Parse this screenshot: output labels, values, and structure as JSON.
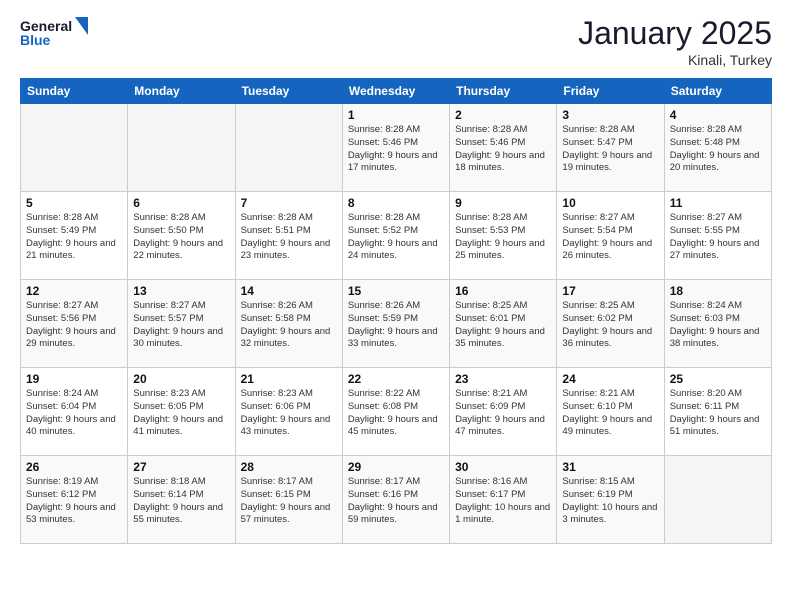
{
  "logo": {
    "line1": "General",
    "line2": "Blue"
  },
  "header": {
    "month": "January 2025",
    "location": "Kinali, Turkey"
  },
  "weekdays": [
    "Sunday",
    "Monday",
    "Tuesday",
    "Wednesday",
    "Thursday",
    "Friday",
    "Saturday"
  ],
  "weeks": [
    [
      {
        "day": "",
        "info": ""
      },
      {
        "day": "",
        "info": ""
      },
      {
        "day": "",
        "info": ""
      },
      {
        "day": "1",
        "info": "Sunrise: 8:28 AM\nSunset: 5:46 PM\nDaylight: 9 hours and 17 minutes."
      },
      {
        "day": "2",
        "info": "Sunrise: 8:28 AM\nSunset: 5:46 PM\nDaylight: 9 hours and 18 minutes."
      },
      {
        "day": "3",
        "info": "Sunrise: 8:28 AM\nSunset: 5:47 PM\nDaylight: 9 hours and 19 minutes."
      },
      {
        "day": "4",
        "info": "Sunrise: 8:28 AM\nSunset: 5:48 PM\nDaylight: 9 hours and 20 minutes."
      }
    ],
    [
      {
        "day": "5",
        "info": "Sunrise: 8:28 AM\nSunset: 5:49 PM\nDaylight: 9 hours and 21 minutes."
      },
      {
        "day": "6",
        "info": "Sunrise: 8:28 AM\nSunset: 5:50 PM\nDaylight: 9 hours and 22 minutes."
      },
      {
        "day": "7",
        "info": "Sunrise: 8:28 AM\nSunset: 5:51 PM\nDaylight: 9 hours and 23 minutes."
      },
      {
        "day": "8",
        "info": "Sunrise: 8:28 AM\nSunset: 5:52 PM\nDaylight: 9 hours and 24 minutes."
      },
      {
        "day": "9",
        "info": "Sunrise: 8:28 AM\nSunset: 5:53 PM\nDaylight: 9 hours and 25 minutes."
      },
      {
        "day": "10",
        "info": "Sunrise: 8:27 AM\nSunset: 5:54 PM\nDaylight: 9 hours and 26 minutes."
      },
      {
        "day": "11",
        "info": "Sunrise: 8:27 AM\nSunset: 5:55 PM\nDaylight: 9 hours and 27 minutes."
      }
    ],
    [
      {
        "day": "12",
        "info": "Sunrise: 8:27 AM\nSunset: 5:56 PM\nDaylight: 9 hours and 29 minutes."
      },
      {
        "day": "13",
        "info": "Sunrise: 8:27 AM\nSunset: 5:57 PM\nDaylight: 9 hours and 30 minutes."
      },
      {
        "day": "14",
        "info": "Sunrise: 8:26 AM\nSunset: 5:58 PM\nDaylight: 9 hours and 32 minutes."
      },
      {
        "day": "15",
        "info": "Sunrise: 8:26 AM\nSunset: 5:59 PM\nDaylight: 9 hours and 33 minutes."
      },
      {
        "day": "16",
        "info": "Sunrise: 8:25 AM\nSunset: 6:01 PM\nDaylight: 9 hours and 35 minutes."
      },
      {
        "day": "17",
        "info": "Sunrise: 8:25 AM\nSunset: 6:02 PM\nDaylight: 9 hours and 36 minutes."
      },
      {
        "day": "18",
        "info": "Sunrise: 8:24 AM\nSunset: 6:03 PM\nDaylight: 9 hours and 38 minutes."
      }
    ],
    [
      {
        "day": "19",
        "info": "Sunrise: 8:24 AM\nSunset: 6:04 PM\nDaylight: 9 hours and 40 minutes."
      },
      {
        "day": "20",
        "info": "Sunrise: 8:23 AM\nSunset: 6:05 PM\nDaylight: 9 hours and 41 minutes."
      },
      {
        "day": "21",
        "info": "Sunrise: 8:23 AM\nSunset: 6:06 PM\nDaylight: 9 hours and 43 minutes."
      },
      {
        "day": "22",
        "info": "Sunrise: 8:22 AM\nSunset: 6:08 PM\nDaylight: 9 hours and 45 minutes."
      },
      {
        "day": "23",
        "info": "Sunrise: 8:21 AM\nSunset: 6:09 PM\nDaylight: 9 hours and 47 minutes."
      },
      {
        "day": "24",
        "info": "Sunrise: 8:21 AM\nSunset: 6:10 PM\nDaylight: 9 hours and 49 minutes."
      },
      {
        "day": "25",
        "info": "Sunrise: 8:20 AM\nSunset: 6:11 PM\nDaylight: 9 hours and 51 minutes."
      }
    ],
    [
      {
        "day": "26",
        "info": "Sunrise: 8:19 AM\nSunset: 6:12 PM\nDaylight: 9 hours and 53 minutes."
      },
      {
        "day": "27",
        "info": "Sunrise: 8:18 AM\nSunset: 6:14 PM\nDaylight: 9 hours and 55 minutes."
      },
      {
        "day": "28",
        "info": "Sunrise: 8:17 AM\nSunset: 6:15 PM\nDaylight: 9 hours and 57 minutes."
      },
      {
        "day": "29",
        "info": "Sunrise: 8:17 AM\nSunset: 6:16 PM\nDaylight: 9 hours and 59 minutes."
      },
      {
        "day": "30",
        "info": "Sunrise: 8:16 AM\nSunset: 6:17 PM\nDaylight: 10 hours and 1 minute."
      },
      {
        "day": "31",
        "info": "Sunrise: 8:15 AM\nSunset: 6:19 PM\nDaylight: 10 hours and 3 minutes."
      },
      {
        "day": "",
        "info": ""
      }
    ]
  ]
}
